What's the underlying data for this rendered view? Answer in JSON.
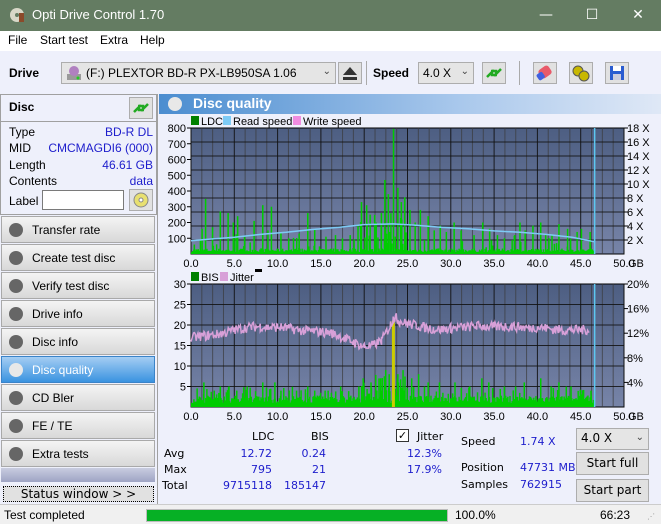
{
  "window": {
    "title": "Opti Drive Control 1.70",
    "minimize": "—",
    "maximize": "☐",
    "close": "✕"
  },
  "menu": {
    "items": [
      "File",
      "Start test",
      "Extra",
      "Help"
    ],
    "underline": [
      "F",
      "S",
      "x",
      "H"
    ]
  },
  "toolbar": {
    "drive_label": "Drive",
    "drive_value": "(F:)  PLEXTOR BD-R  PX-LB950SA 1.06",
    "speed_label": "Speed",
    "speed_value": "4.0 X"
  },
  "disc": {
    "header": "Disc",
    "rows": [
      {
        "key": "Type",
        "value": "BD-R DL"
      },
      {
        "key": "MID",
        "value": "CMCMAGDI6 (000)"
      },
      {
        "key": "Length",
        "value": "46.61 GB"
      },
      {
        "key": "Contents",
        "value": "data"
      }
    ],
    "label_key": "Label",
    "label_value": ""
  },
  "nav": {
    "items": [
      {
        "label": "Transfer rate",
        "active": false
      },
      {
        "label": "Create test disc",
        "active": false
      },
      {
        "label": "Verify test disc",
        "active": false
      },
      {
        "label": "Drive info",
        "active": false
      },
      {
        "label": "Disc info",
        "active": false
      },
      {
        "label": "Disc quality",
        "active": true
      },
      {
        "label": "CD Bler",
        "active": false
      },
      {
        "label": "FE / TE",
        "active": false
      },
      {
        "label": "Extra tests",
        "active": false
      }
    ],
    "status_window": "Status window > >"
  },
  "panel": {
    "title": "Disc quality"
  },
  "chart_data": [
    {
      "type": "bar",
      "title": "",
      "legend": [
        {
          "name": "LDC",
          "color": "#008000"
        },
        {
          "name": "Read speed",
          "color": "#7ecbf5"
        },
        {
          "name": "Write speed",
          "color": "#f08ce0"
        }
      ],
      "legend_position": "top-left",
      "xlabel": "GB",
      "xlim": [
        0,
        50
      ],
      "x_ticks": [
        "0.0",
        "5.0",
        "10.0",
        "15.0",
        "20.0",
        "25.0",
        "30.0",
        "35.0",
        "40.0",
        "45.0",
        "50.0"
      ],
      "ylim": [
        0,
        800
      ],
      "y_ticks": [
        "100",
        "200",
        "300",
        "400",
        "500",
        "600",
        "700",
        "800"
      ],
      "y2lim": [
        0,
        18
      ],
      "y2_ticks": [
        "2 X",
        "4 X",
        "6 X",
        "8 X",
        "10 X",
        "12 X",
        "14 X",
        "16 X",
        "18 X"
      ],
      "grid": true,
      "disc_end_gb": 46.61,
      "ldc_peaks": [
        [
          0.3,
          60
        ],
        [
          1.2,
          160
        ],
        [
          1.6,
          350
        ],
        [
          2.4,
          170
        ],
        [
          3.3,
          270
        ],
        [
          4.2,
          260
        ],
        [
          4.8,
          200
        ],
        [
          5.3,
          240
        ],
        [
          6.1,
          110
        ],
        [
          7.2,
          210
        ],
        [
          8.2,
          310
        ],
        [
          8.8,
          150
        ],
        [
          9.2,
          300
        ],
        [
          10.3,
          140
        ],
        [
          11.2,
          100
        ],
        [
          12.4,
          130
        ],
        [
          13.4,
          260
        ],
        [
          14.2,
          160
        ],
        [
          15.5,
          110
        ],
        [
          16.6,
          120
        ],
        [
          17.4,
          100
        ],
        [
          18.3,
          120
        ],
        [
          19.2,
          180
        ],
        [
          19.6,
          330
        ],
        [
          20.2,
          310
        ],
        [
          20.6,
          250
        ],
        [
          21.3,
          200
        ],
        [
          21.9,
          260
        ],
        [
          22.3,
          470
        ],
        [
          22.7,
          380
        ],
        [
          23.3,
          795
        ],
        [
          23.8,
          420
        ],
        [
          24.2,
          330
        ],
        [
          24.6,
          360
        ],
        [
          25.2,
          280
        ],
        [
          25.8,
          200
        ],
        [
          26.4,
          280
        ],
        [
          27.3,
          240
        ],
        [
          28.0,
          150
        ],
        [
          28.7,
          180
        ],
        [
          29.4,
          140
        ],
        [
          30.3,
          200
        ],
        [
          31.1,
          150
        ],
        [
          32.6,
          120
        ],
        [
          33.6,
          200
        ],
        [
          34.4,
          160
        ],
        [
          35.3,
          120
        ],
        [
          36.1,
          100
        ],
        [
          37.3,
          120
        ],
        [
          37.9,
          200
        ],
        [
          38.5,
          150
        ],
        [
          39.4,
          180
        ],
        [
          40.3,
          200
        ],
        [
          41.6,
          120
        ],
        [
          42.4,
          190
        ],
        [
          43.4,
          160
        ],
        [
          44.5,
          140
        ],
        [
          45.0,
          160
        ],
        [
          46.0,
          140
        ]
      ],
      "ldc_baseline": 25,
      "read_speed": [
        [
          0,
          1.9
        ],
        [
          2,
          2.1
        ],
        [
          5,
          2.4
        ],
        [
          8,
          2.8
        ],
        [
          11,
          3.1
        ],
        [
          14,
          3.5
        ],
        [
          17,
          3.8
        ],
        [
          20,
          4.2
        ],
        [
          23.3,
          4.3
        ],
        [
          26,
          4.1
        ],
        [
          29,
          3.8
        ],
        [
          32,
          3.6
        ],
        [
          35,
          3.3
        ],
        [
          38,
          3.1
        ],
        [
          41,
          2.8
        ],
        [
          44,
          2.4
        ],
        [
          46.61,
          1.74
        ]
      ]
    },
    {
      "type": "bar",
      "title": "",
      "legend": [
        {
          "name": "BIS",
          "color": "#008000"
        },
        {
          "name": "Jitter",
          "color": "#d8a0d8"
        }
      ],
      "legend_position": "top-left",
      "xlabel": "GB",
      "xlim": [
        0,
        50
      ],
      "x_ticks": [
        "0.0",
        "5.0",
        "10.0",
        "15.0",
        "20.0",
        "25.0",
        "30.0",
        "35.0",
        "40.0",
        "45.0",
        "50.0"
      ],
      "ylim": [
        0,
        30
      ],
      "y_ticks": [
        "5",
        "10",
        "15",
        "20",
        "25",
        "30"
      ],
      "y2lim": [
        0,
        20
      ],
      "y2_ticks": [
        "4%",
        "8%",
        "12%",
        "16%",
        "20%"
      ],
      "grid": true,
      "disc_end_gb": 46.61,
      "bis_peaks": [
        [
          1.4,
          6
        ],
        [
          2.6,
          4
        ],
        [
          3.3,
          5
        ],
        [
          4.3,
          5
        ],
        [
          5.2,
          4
        ],
        [
          6.4,
          5
        ],
        [
          8.2,
          6
        ],
        [
          9.6,
          6
        ],
        [
          10.3,
          4
        ],
        [
          12.1,
          4
        ],
        [
          13.4,
          5
        ],
        [
          14.2,
          4
        ],
        [
          15.4,
          4
        ],
        [
          17.2,
          5
        ],
        [
          19.3,
          5
        ],
        [
          19.8,
          7
        ],
        [
          20.7,
          6
        ],
        [
          21.8,
          7
        ],
        [
          22.4,
          9
        ],
        [
          22.8,
          8
        ],
        [
          23.2,
          21
        ],
        [
          23.8,
          8
        ],
        [
          24.4,
          9
        ],
        [
          25.4,
          7
        ],
        [
          26.2,
          8
        ],
        [
          27.3,
          6
        ],
        [
          28.6,
          6
        ],
        [
          30.4,
          6
        ],
        [
          32.1,
          5
        ],
        [
          33.5,
          7
        ],
        [
          34.3,
          6
        ],
        [
          36.1,
          5
        ],
        [
          37.4,
          5
        ],
        [
          38.4,
          6
        ],
        [
          40.3,
          7
        ],
        [
          41.5,
          5
        ],
        [
          42.4,
          6
        ],
        [
          43.8,
          5
        ],
        [
          45.2,
          4
        ],
        [
          46.1,
          4
        ]
      ],
      "bis_baseline": 2,
      "jitter": [
        [
          0,
          11.2
        ],
        [
          1,
          11.5
        ],
        [
          2,
          11.6
        ],
        [
          3,
          11.8
        ],
        [
          4,
          12.1
        ],
        [
          5,
          12.5
        ],
        [
          6,
          12.8
        ],
        [
          7,
          13
        ],
        [
          8,
          13.1
        ],
        [
          9,
          12.9
        ],
        [
          10,
          13
        ],
        [
          11,
          12.8
        ],
        [
          12,
          12.6
        ],
        [
          13,
          12.4
        ],
        [
          14,
          12.3
        ],
        [
          15,
          12.2
        ],
        [
          16,
          12.1
        ],
        [
          17,
          11.6
        ],
        [
          18,
          11
        ],
        [
          19,
          10.4
        ],
        [
          20,
          9.8
        ],
        [
          21,
          10
        ],
        [
          22,
          10.8
        ],
        [
          23,
          13.2
        ],
        [
          23.5,
          14.8
        ],
        [
          24,
          14
        ],
        [
          25,
          13.5
        ],
        [
          26,
          13.3
        ],
        [
          27,
          12.9
        ],
        [
          28,
          12.7
        ],
        [
          29,
          12.6
        ],
        [
          30,
          12.8
        ],
        [
          31,
          12.9
        ],
        [
          32,
          13
        ],
        [
          33,
          13.2
        ],
        [
          34,
          13.1
        ],
        [
          35,
          13
        ],
        [
          36,
          13.1
        ],
        [
          37,
          13.1
        ],
        [
          38,
          13
        ],
        [
          39,
          12.8
        ],
        [
          40,
          13
        ],
        [
          41,
          12.8
        ],
        [
          42,
          12.6
        ],
        [
          43,
          12.5
        ],
        [
          44,
          12.5
        ],
        [
          45,
          12.5
        ],
        [
          46,
          12.6
        ]
      ]
    }
  ],
  "stats": {
    "col_ldc": "LDC",
    "col_bis": "BIS",
    "jitter_label": "Jitter",
    "jitter_checked": true,
    "rows": [
      {
        "label": "Avg",
        "ldc": "12.72",
        "bis": "0.24",
        "jitter": "12.3%"
      },
      {
        "label": "Max",
        "ldc": "795",
        "bis": "21",
        "jitter": "17.9%"
      },
      {
        "label": "Total",
        "ldc": "9715118",
        "bis": "185147",
        "jitter": ""
      }
    ],
    "speed_label": "Speed",
    "speed_value": "1.74 X",
    "position_label": "Position",
    "position_value": "47731 MB",
    "samples_label": "Samples",
    "samples_value": "762915",
    "speed_select": "4.0 X",
    "start_full": "Start full",
    "start_part": "Start part"
  },
  "statusbar": {
    "text": "Test completed",
    "progress": 100.0,
    "progress_text": "100.0%",
    "elapsed": "66:23"
  },
  "colors": {
    "titlebar": "#647c62",
    "plot_bg_top": "#4d5e82",
    "plot_bg_bottom": "#7784a8",
    "ldc": "#00cc00",
    "read_speed": "#7ecbf5",
    "jitter": "#d8a0d8",
    "bis_peak": "#cccc00",
    "progress": "#06b025",
    "value_text": "#1d1dcc"
  }
}
